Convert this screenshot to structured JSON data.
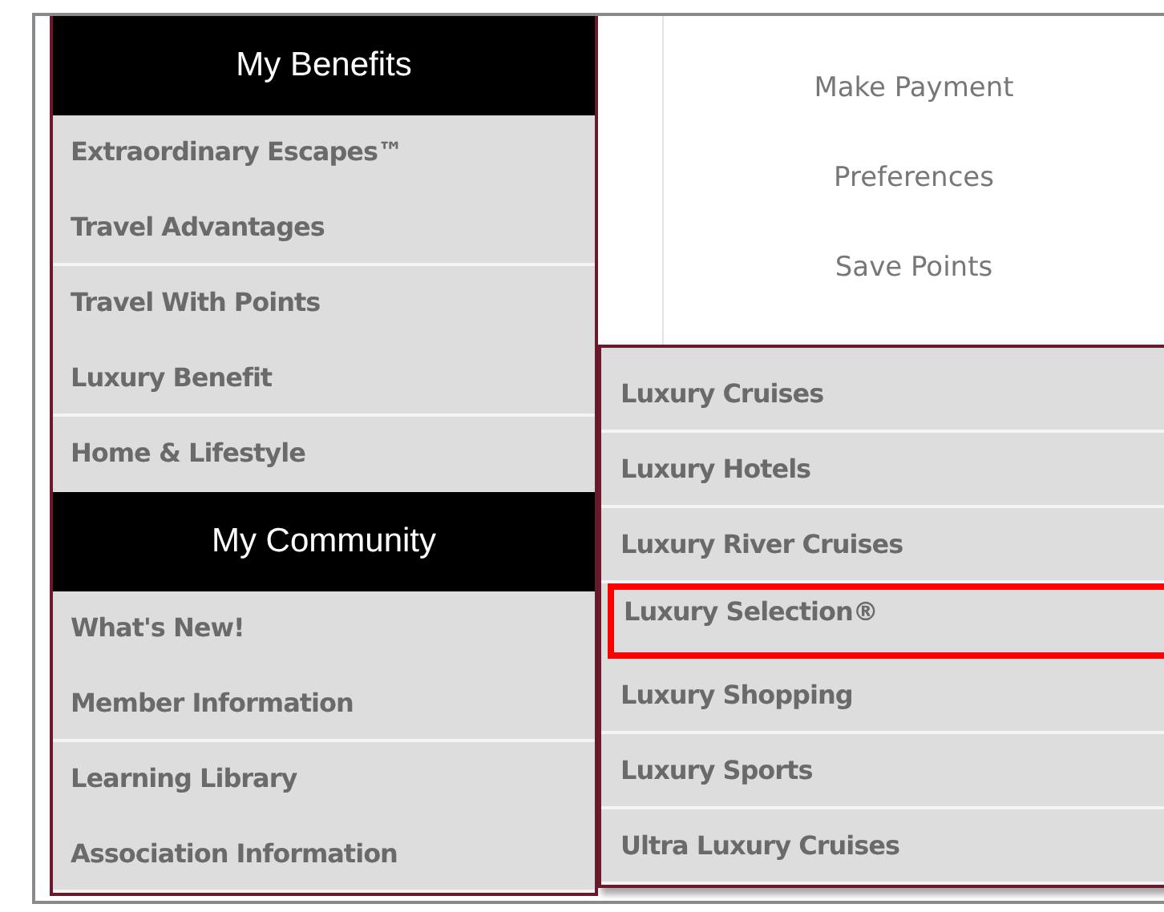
{
  "sections": [
    {
      "title": "My Benefits",
      "items": [
        {
          "label": "Extraordinary Escapes™"
        },
        {
          "label": "Travel Advantages"
        },
        {
          "label": "Travel With Points"
        },
        {
          "label": "Luxury Benefit"
        },
        {
          "label": "Home & Lifestyle"
        }
      ]
    },
    {
      "title": "My Community",
      "items": [
        {
          "label": "What's New!"
        },
        {
          "label": "Member Information"
        },
        {
          "label": "Learning Library"
        },
        {
          "label": "Association Information"
        }
      ]
    }
  ],
  "account_links": [
    "Make Payment",
    "Preferences",
    "Save Points"
  ],
  "submenu": [
    {
      "label": "Luxury Cruises",
      "selected": false
    },
    {
      "label": "Luxury Hotels",
      "selected": false
    },
    {
      "label": "Luxury River Cruises",
      "selected": false
    },
    {
      "label": "Luxury Selection®",
      "selected": true
    },
    {
      "label": "Luxury Shopping",
      "selected": false
    },
    {
      "label": "Luxury Sports",
      "selected": false
    },
    {
      "label": "Ultra Luxury Cruises",
      "selected": false
    }
  ]
}
